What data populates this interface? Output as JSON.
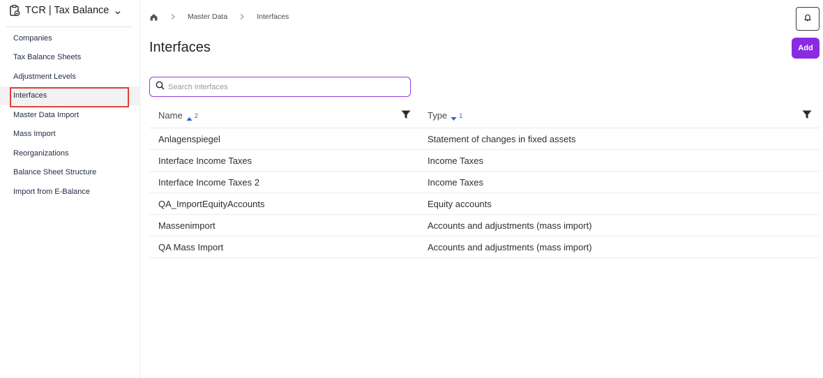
{
  "app": {
    "title": "TCR | Tax Balance"
  },
  "sidebar": {
    "items": [
      {
        "label": "Companies"
      },
      {
        "label": "Tax Balance Sheets"
      },
      {
        "label": "Adjustment Levels"
      },
      {
        "label": "Interfaces",
        "active": true
      },
      {
        "label": "Master Data Import"
      },
      {
        "label": "Mass Import"
      },
      {
        "label": "Reorganizations"
      },
      {
        "label": "Balance Sheet Structure"
      },
      {
        "label": "Import from E-Balance"
      }
    ]
  },
  "breadcrumb": {
    "items": [
      "Master Data",
      "Interfaces"
    ]
  },
  "page": {
    "title": "Interfaces",
    "add_label": "Add"
  },
  "search": {
    "placeholder": "Search interfaces",
    "value": ""
  },
  "table": {
    "columns": [
      {
        "label": "Name",
        "sort": "asc",
        "sort_rank": "2"
      },
      {
        "label": "Type",
        "sort": "desc",
        "sort_rank": "1"
      }
    ],
    "rows": [
      {
        "name": "Anlagenspiegel",
        "type": "Statement of changes in fixed assets"
      },
      {
        "name": "Interface Income Taxes",
        "type": "Income Taxes"
      },
      {
        "name": "Interface Income Taxes 2",
        "type": "Income Taxes"
      },
      {
        "name": "QA_ImportEquityAccounts",
        "type": "Equity accounts"
      },
      {
        "name": "Massenimport",
        "type": "Accounts and adjustments (mass import)"
      },
      {
        "name": "QA Mass Import",
        "type": "Accounts and adjustments (mass import)"
      }
    ]
  },
  "icons": {
    "app": "clipboard-check-icon",
    "home": "home-icon",
    "bell": "bell-icon",
    "search": "search-icon",
    "filter": "filter-icon"
  },
  "colors": {
    "accent": "#8a2be2",
    "highlight": "#e0403a",
    "sort": "#2a5fd1"
  }
}
